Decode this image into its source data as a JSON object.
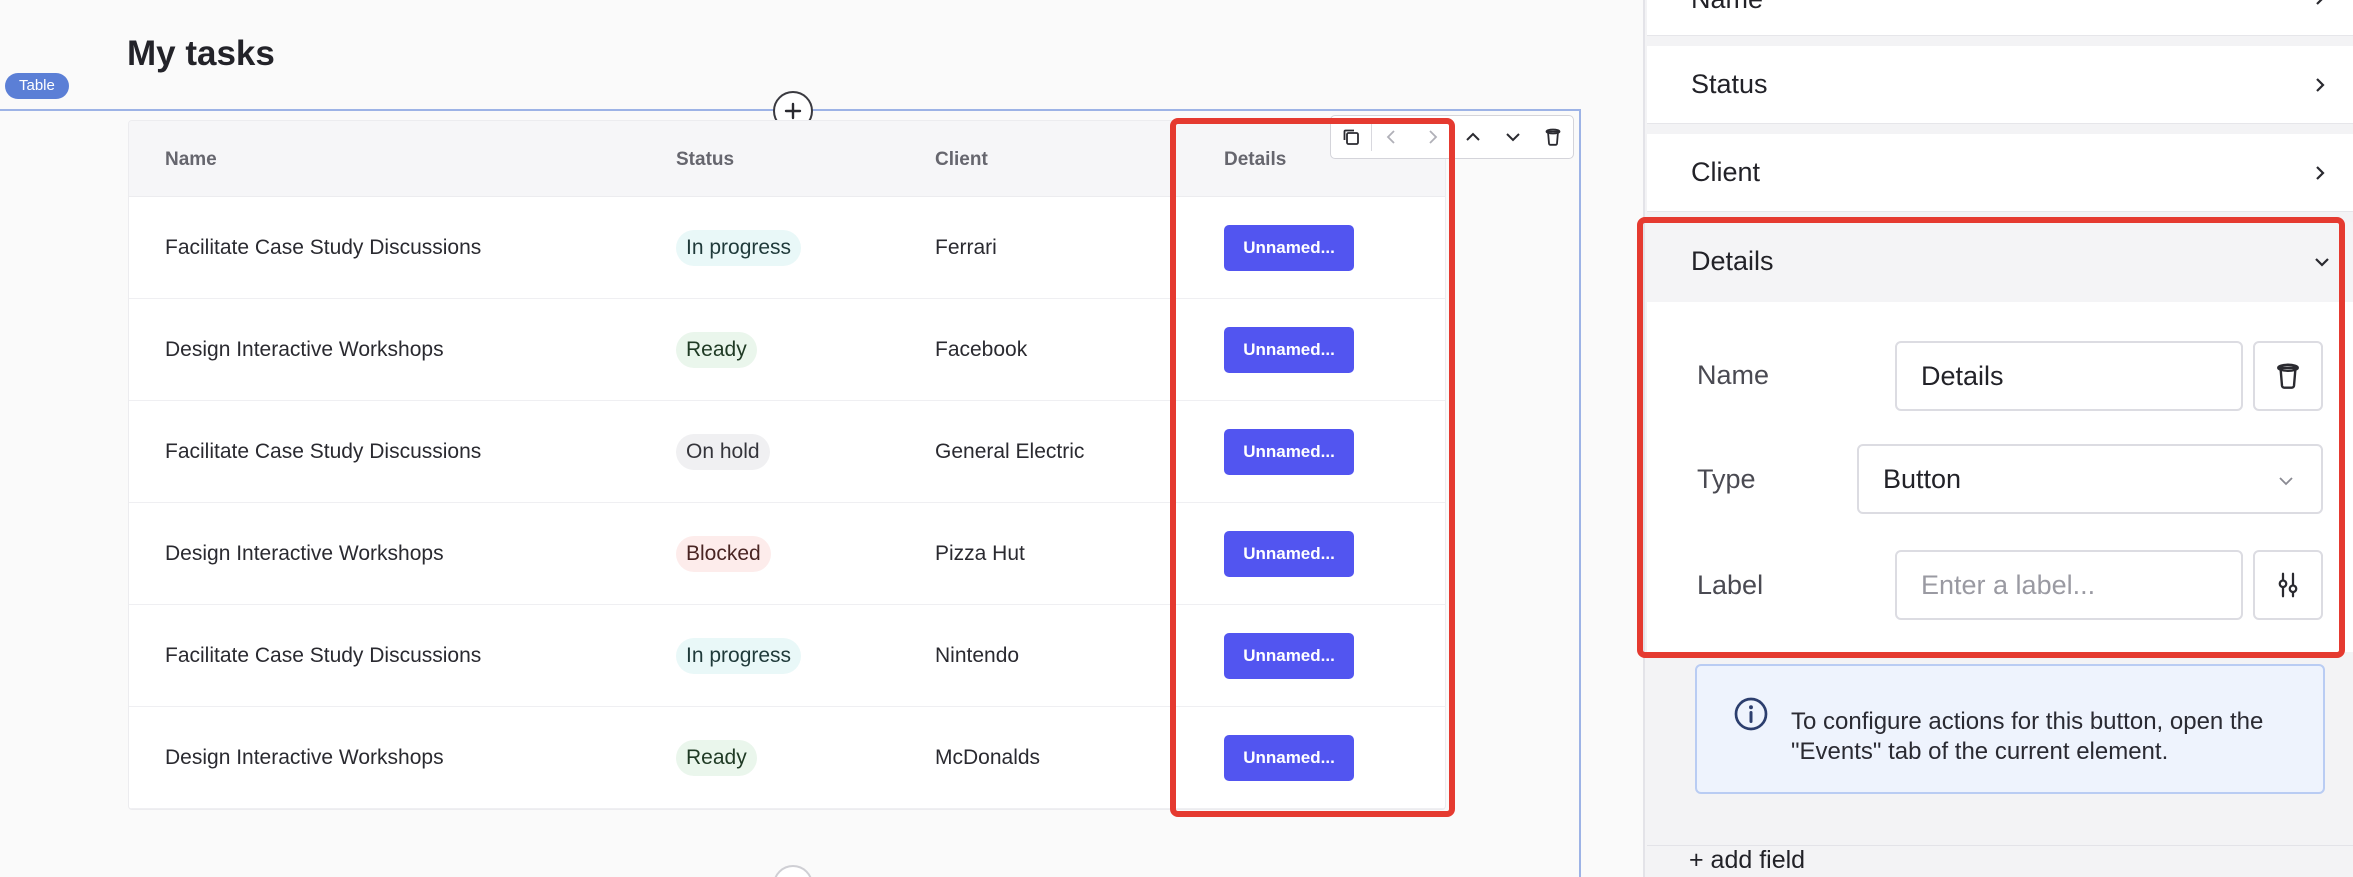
{
  "canvas": {
    "title": "My tasks",
    "badge": "Table",
    "columns": [
      "Name",
      "Status",
      "Client",
      "Details"
    ],
    "rows": [
      {
        "name": "Facilitate Case Study Discussions",
        "status": "In progress",
        "client": "Ferrari",
        "button": "Unnamed..."
      },
      {
        "name": "Design Interactive Workshops",
        "status": "Ready",
        "client": "Facebook",
        "button": "Unnamed..."
      },
      {
        "name": "Facilitate Case Study Discussions",
        "status": "On hold",
        "client": "General Electric",
        "button": "Unnamed..."
      },
      {
        "name": "Design Interactive Workshops",
        "status": "Blocked",
        "client": "Pizza Hut",
        "button": "Unnamed..."
      },
      {
        "name": "Facilitate Case Study Discussions",
        "status": "In progress",
        "client": "Nintendo",
        "button": "Unnamed..."
      },
      {
        "name": "Design Interactive Workshops",
        "status": "Ready",
        "client": "McDonalds",
        "button": "Unnamed..."
      }
    ],
    "status_colors": {
      "In progress": {
        "bg": "#e9f8f8",
        "fg": "#1f3a3a"
      },
      "Ready": {
        "bg": "#eaf6ec",
        "fg": "#1f3a24"
      },
      "On hold": {
        "bg": "#f0f0f2",
        "fg": "#35353b"
      },
      "Blocked": {
        "bg": "#fdeceb",
        "fg": "#4a2523"
      }
    },
    "toolbar_icons": [
      "duplicate-icon",
      "chevron-left-icon",
      "chevron-right-icon",
      "chevron-up-icon",
      "chevron-down-icon",
      "trash-icon"
    ]
  },
  "panel": {
    "sections": {
      "name": "Name",
      "status": "Status",
      "client": "Client",
      "details": "Details"
    },
    "details": {
      "name_label": "Name",
      "name_value": "Details",
      "type_label": "Type",
      "type_value": "Button",
      "label_label": "Label",
      "label_placeholder": "Enter a label...",
      "info": "To configure actions for this button, open the \"Events\" tab of the current element."
    },
    "add_field": "+ add field"
  },
  "colors": {
    "accent": "#5255f0",
    "highlight": "#e53a30",
    "selection": "#9db3e6"
  }
}
